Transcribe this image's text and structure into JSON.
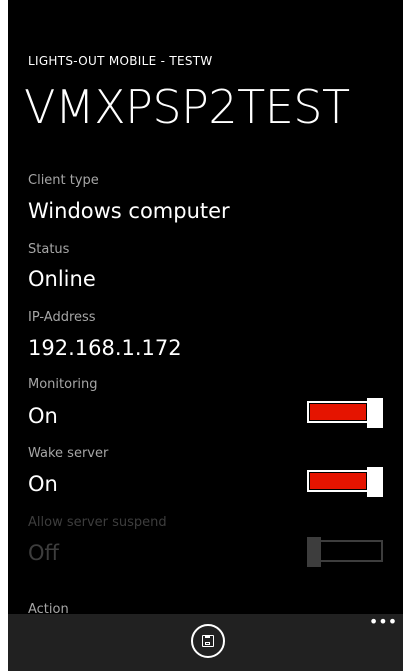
{
  "app": {
    "title": "LIGHTS-OUT MOBILE - TESTW",
    "page_title": "VMXPSP2TEST"
  },
  "fields": {
    "client_type": {
      "label": "Client type",
      "value": "Windows computer"
    },
    "status": {
      "label": "Status",
      "value": "Online"
    },
    "ip_address": {
      "label": "IP-Address",
      "value": "192.168.1.172"
    }
  },
  "toggles": {
    "monitoring": {
      "label": "Monitoring",
      "state_text": "On",
      "on": true,
      "enabled": true
    },
    "wake_server": {
      "label": "Wake server",
      "state_text": "On",
      "on": true,
      "enabled": true
    },
    "allow_server_suspend": {
      "label": "Allow server suspend",
      "state_text": "Off",
      "on": false,
      "enabled": false
    }
  },
  "partial": {
    "label": "Action"
  },
  "appbar": {
    "save_icon": "save-icon",
    "more_glyph": "•••"
  },
  "colors": {
    "accent": "#e51400",
    "background": "#000000",
    "appbar": "#212121",
    "label": "#a6a6a6",
    "disabled": "#3d3d3d"
  }
}
